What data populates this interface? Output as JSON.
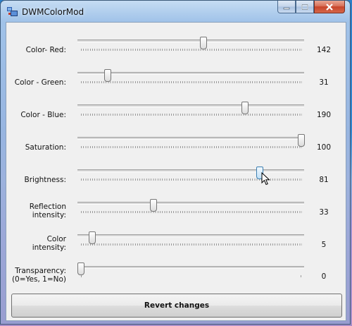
{
  "window": {
    "title": "DWMColorMod"
  },
  "sliders": [
    {
      "label": "Color- Red:",
      "value": "142",
      "level": 0.557
    },
    {
      "label": "Color - Green:",
      "value": "31",
      "level": 0.122
    },
    {
      "label": "Color - Blue:",
      "value": "190",
      "level": 0.745
    },
    {
      "label": "Saturation:",
      "value": "100",
      "level": 1.0
    },
    {
      "label": "Brightness:",
      "value": "81",
      "level": 0.81
    },
    {
      "label_line1": "Reflection",
      "label_line2": "intensity:",
      "value": "33",
      "level": 0.33
    },
    {
      "label_line1": "Color",
      "label_line2": "intensity:",
      "value": "5",
      "level": 0.05
    },
    {
      "label_line1": "Transparency:",
      "label_line2": "(0=Yes, 1=No)",
      "value": "0",
      "level": 0.0
    }
  ],
  "revert_label": "Revert changes",
  "icons": {
    "app": "dwm-app-icon",
    "minimize": "minimize-icon",
    "maximize": "maximize-icon",
    "close": "close-icon",
    "cursor": "mouse-pointer-icon"
  }
}
